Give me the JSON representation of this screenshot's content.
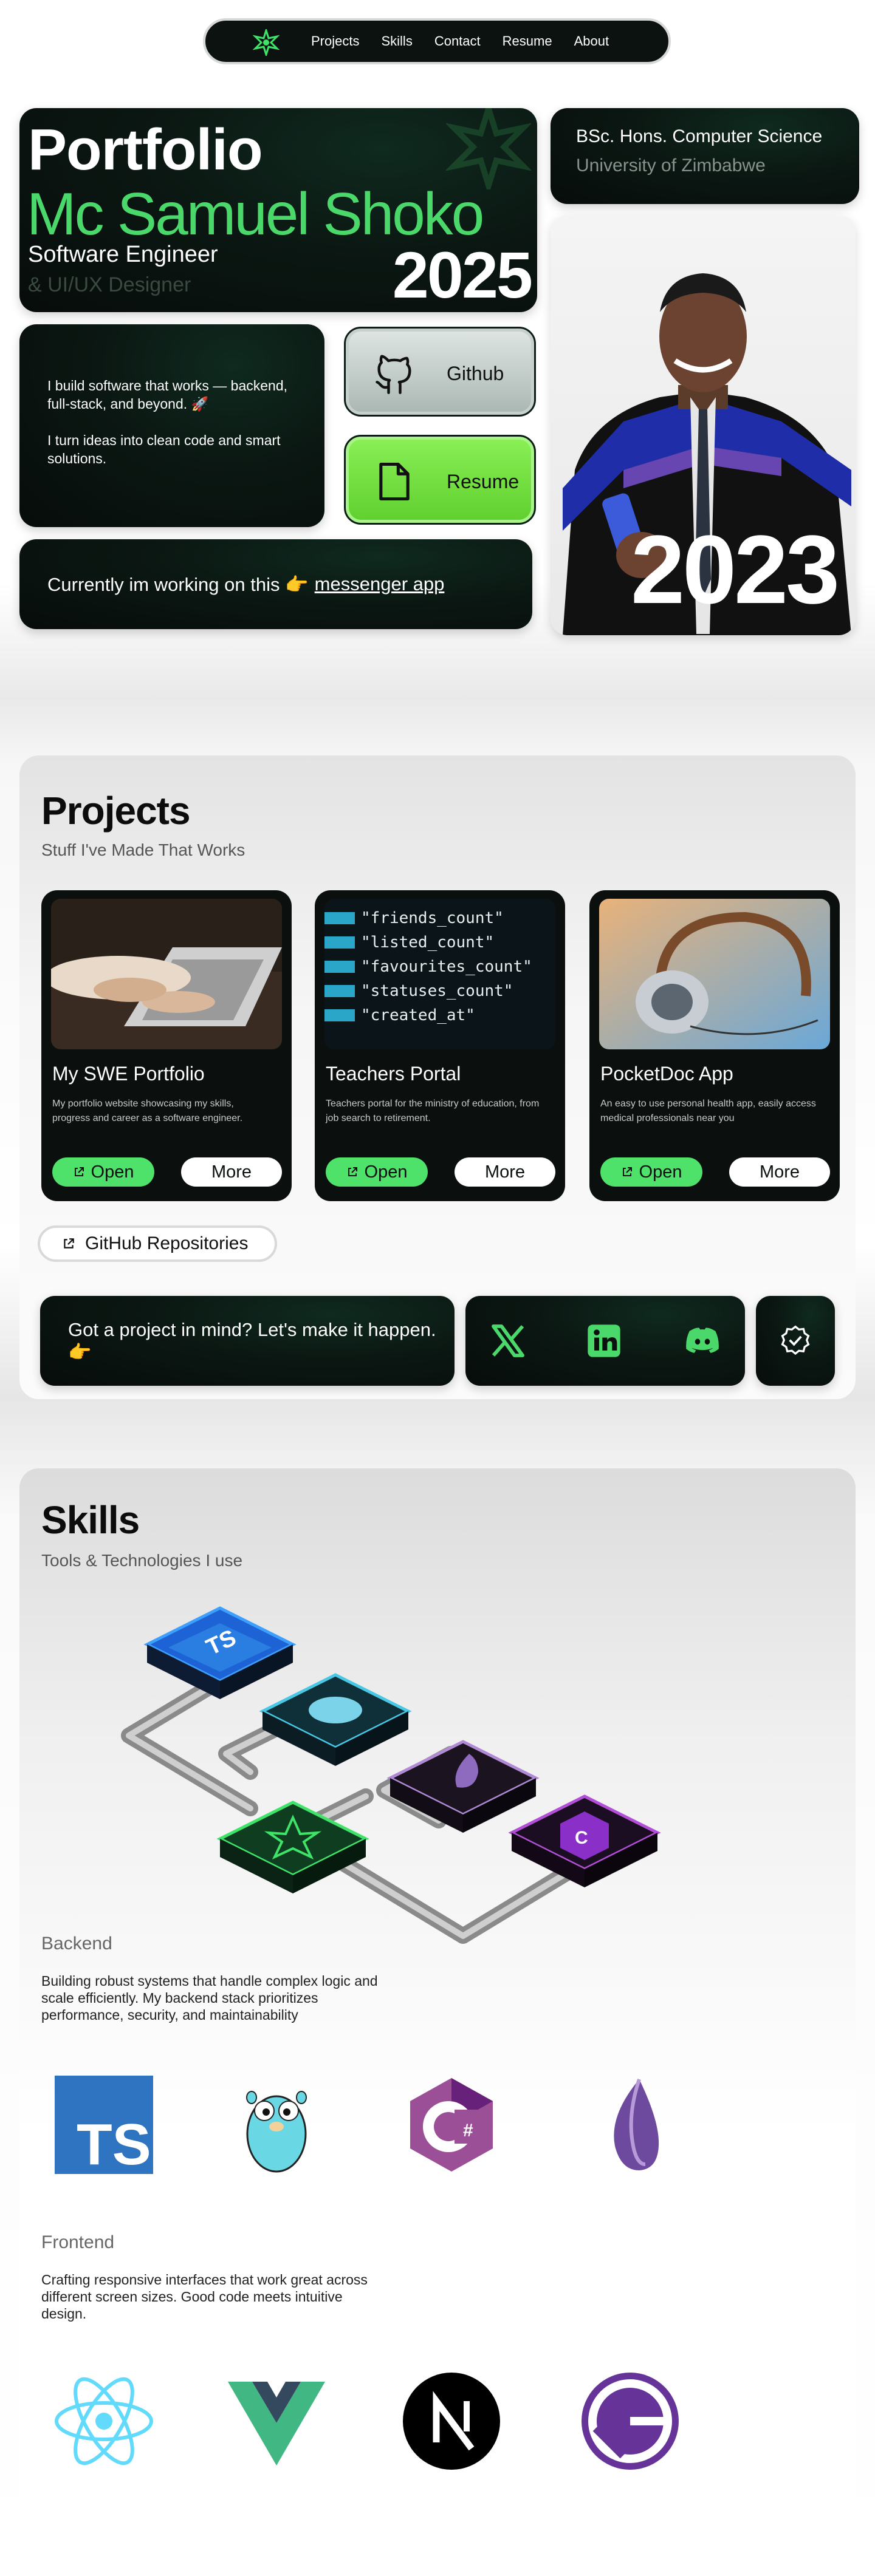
{
  "nav": {
    "links": [
      "Projects",
      "Skills",
      "Contact",
      "Resume",
      "About"
    ],
    "logo_icon": "star-logo-icon"
  },
  "hero": {
    "title": "Portfolio",
    "name": "Mc Samuel Shoko",
    "role": "Software Engineer",
    "role2": "& UI/UX Designer",
    "year": "2025"
  },
  "education": {
    "degree": "BSc. Hons. Computer Science",
    "university": "University of Zimbabwe"
  },
  "photo": {
    "year": "2023"
  },
  "bio": {
    "line1": "I build software that works — backend, full-stack, and beyond. 🚀",
    "line2": "I turn ideas into clean code and smart solutions."
  },
  "buttons": {
    "github": "Github",
    "resume": "Resume"
  },
  "working": {
    "text": "Currently im working on this 👉",
    "link": "messenger app"
  },
  "projects": {
    "title": "Projects",
    "subtitle": "Stuff I've Made That Works",
    "open_label": "Open",
    "more_label": "More",
    "items": [
      {
        "title": "My SWE Portfolio",
        "desc": "My portfolio website showcasing my skills, progress and career as a software engineer."
      },
      {
        "title": "Teachers Portal",
        "desc": "Teachers portal for the ministry of education, from job search to retirement."
      },
      {
        "title": "PocketDoc App",
        "desc": "An easy to use personal health app, easily access medical professionals near you"
      }
    ],
    "repos_label": "GitHub Repositories",
    "cta": "Got a project in mind? Let's make it happen. 👉"
  },
  "skills": {
    "title": "Skills",
    "subtitle": "Tools & Technologies I use",
    "backend": {
      "label": "Backend",
      "desc": "Building robust systems that handle complex logic and scale efficiently. My backend stack prioritizes performance, security, and maintainability"
    },
    "frontend": {
      "label": "Frontend",
      "desc": "Crafting responsive interfaces that work great across different screen sizes. Good code meets intuitive design."
    },
    "backend_icons": [
      "typescript-icon",
      "golang-gopher-icon",
      "csharp-icon",
      "elixir-icon"
    ],
    "frontend_icons": [
      "react-icon",
      "vue-icon",
      "nextjs-icon",
      "gatsby-icon"
    ]
  },
  "colors": {
    "accent": "#4bd86a",
    "dark": "#0b100e"
  }
}
